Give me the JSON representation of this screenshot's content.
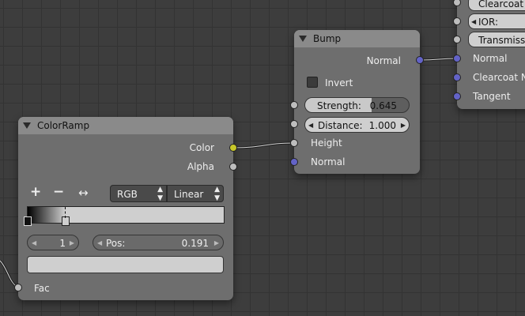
{
  "bump_node": {
    "title": "Bump",
    "output_normal": "Normal",
    "invert_label": "Invert",
    "strength_label": "Strength:",
    "strength_value": "0.645",
    "strength_fill": 0.645,
    "distance_label": "Distance:",
    "distance_value": "1.000",
    "input_height": "Height",
    "input_normal": "Normal"
  },
  "colorramp_node": {
    "title": "ColorRamp",
    "output_color": "Color",
    "output_alpha": "Alpha",
    "add_icon": "+",
    "remove_icon": "−",
    "flip_icon": "↔",
    "color_mode": "RGB",
    "interpolation": "Linear",
    "stop_index": "1",
    "pos_label": "Pos:",
    "pos_value": "0.191",
    "input_fac": "Fac"
  },
  "principled_node": {
    "clearcoat": "Clearcoat I",
    "ior_label": "IOR:",
    "transmission": "Transmissi",
    "input_normal": "Normal",
    "input_clearcoat_normal": "Clearcoat No",
    "input_tangent": "Tangent"
  },
  "colors": {
    "socket_vector": "#6363c7",
    "socket_color": "#c7c729",
    "socket_float": "#bdbdbd"
  }
}
